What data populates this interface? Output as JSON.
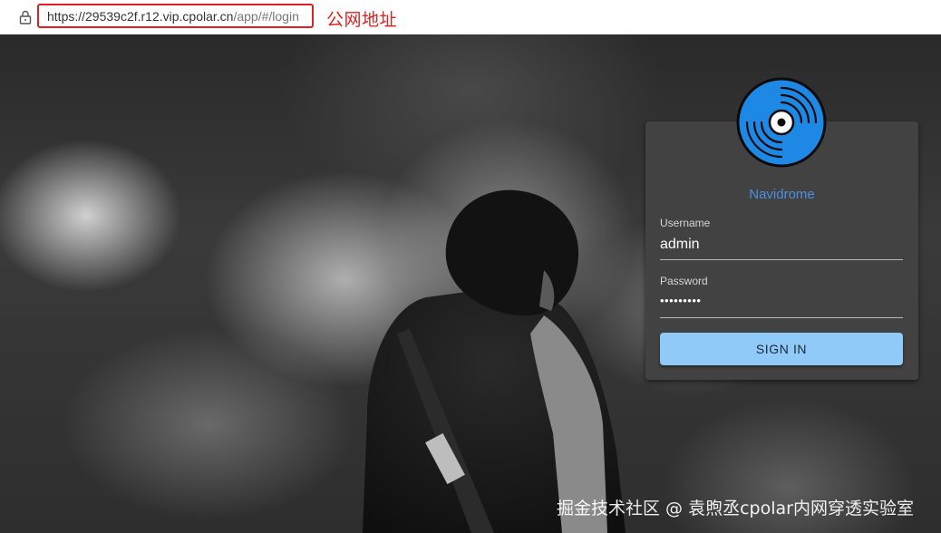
{
  "browser": {
    "url_main": "https://29539c2f.r12.vip.cpolar.cn",
    "url_path": "/app/#/login",
    "annotation": "公网地址"
  },
  "login": {
    "app_name": "Navidrome",
    "username_label": "Username",
    "username_value": "admin",
    "password_label": "Password",
    "password_value": "•••••••••",
    "sign_in_label": "SIGN IN"
  },
  "watermark": "掘金技术社区 @ 袁煦丞cpolar内网穿透实验室",
  "colors": {
    "annotation_red": "#e02020",
    "brand_blue": "#4a90e2",
    "logo_blue": "#1e88e5",
    "button_blue": "#90caf9",
    "card_bg": "#424242"
  },
  "icons": {
    "lock": "lock-icon",
    "logo": "vinyl-record-icon"
  }
}
